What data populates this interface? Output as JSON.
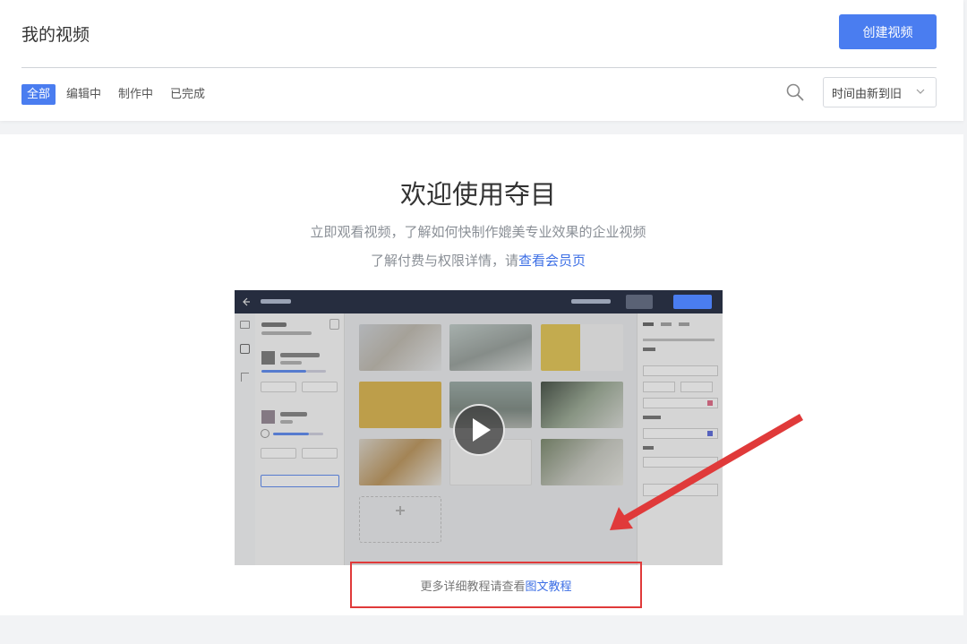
{
  "header": {
    "title": "我的视频",
    "create_button": "创建视频",
    "tabs": [
      {
        "label": "全部",
        "active": true
      },
      {
        "label": "编辑中",
        "active": false
      },
      {
        "label": "制作中",
        "active": false
      },
      {
        "label": "已完成",
        "active": false
      }
    ],
    "search_icon": "search-icon",
    "sort_value": "时间由新到旧"
  },
  "welcome": {
    "title": "欢迎使用夺目",
    "line1": "立即观看视频，了解如何快制作媲美专业效果的企业视频",
    "line2_prefix": "了解付费与权限详情，请",
    "line2_link": "查看会员页"
  },
  "tutorial": {
    "more_prefix": "更多详细教程请查看",
    "more_link": "图文教程"
  },
  "colors": {
    "accent": "#4a7df0",
    "link": "#3d6fe5",
    "highlight_red": "#e03a3a"
  }
}
